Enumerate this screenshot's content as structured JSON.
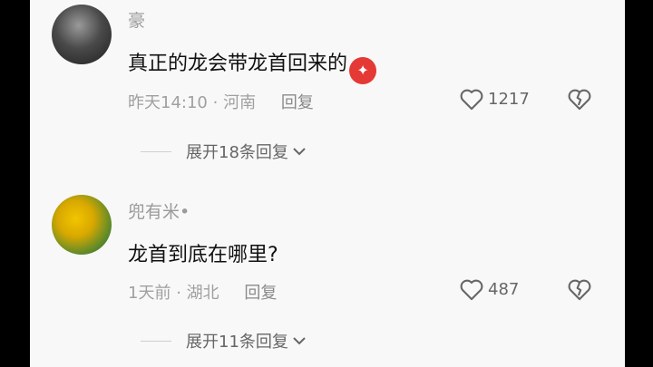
{
  "comments": [
    {
      "username": "豪",
      "text": "真正的龙会带龙首回来的",
      "emoji": "angry-face-emoji",
      "time": "昨天14:10",
      "location": "河南",
      "reply_label": "回复",
      "likes": "1217",
      "expand_label": "展开18条回复"
    },
    {
      "username": "兜有米•",
      "text": "龙首到底在哪里?",
      "time": "1天前",
      "location": "湖北",
      "reply_label": "回复",
      "likes": "487",
      "expand_label": "展开11条回复"
    }
  ],
  "separator": "·",
  "colors": {
    "background": "#f8f8f8",
    "text": "#111111",
    "meta": "#a0a0a0",
    "emoji": "#e53935"
  }
}
